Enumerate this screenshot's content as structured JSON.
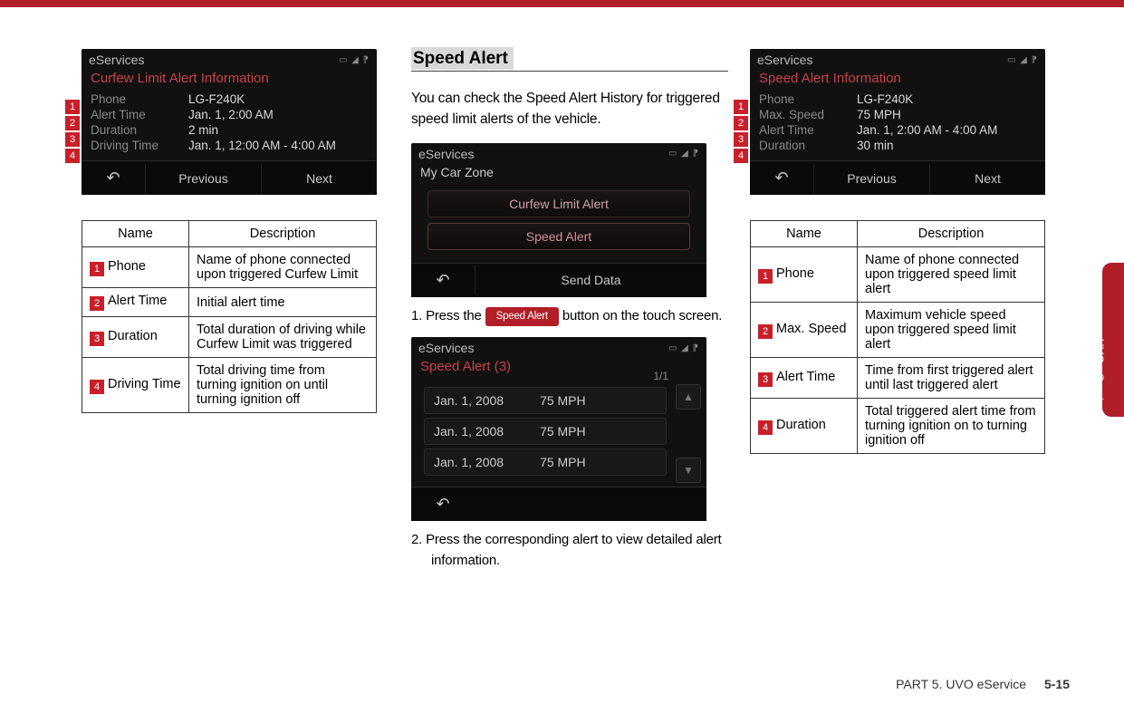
{
  "side_tab": "UVO eServices",
  "footer": {
    "part": "PART 5. UVO eService",
    "page": "5-15"
  },
  "col1": {
    "device": {
      "title": "eServices",
      "heading": "Curfew Limit Alert Information",
      "rows": [
        {
          "label": "Phone",
          "value": "LG-F240K"
        },
        {
          "label": "Alert Time",
          "value": "Jan. 1, 2:00 AM"
        },
        {
          "label": "Duration",
          "value": "2 min"
        },
        {
          "label": "Driving Time",
          "value": "Jan. 1, 12:00 AM - 4:00 AM"
        }
      ],
      "footer": {
        "back": "↶",
        "prev": "Previous",
        "next": "Next"
      }
    },
    "callouts": [
      "1",
      "2",
      "3",
      "4"
    ],
    "table": {
      "head": {
        "name": "Name",
        "desc": "Description"
      },
      "rows": [
        {
          "n": "1",
          "name": "Phone",
          "desc": "Name of phone connected upon triggered Curfew Limit"
        },
        {
          "n": "2",
          "name": "Alert Time",
          "desc": "Initial alert time"
        },
        {
          "n": "3",
          "name": "Duration",
          "desc": "Total duration of driving while Curfew Limit was triggered"
        },
        {
          "n": "4",
          "name": "Driving Time",
          "desc": "Total driving time from turning ignition on until turning ignition off"
        }
      ]
    }
  },
  "col2": {
    "section_title": "Speed Alert",
    "intro": "You can check the Speed Alert History for triggered speed limit alerts of the vehicle.",
    "deviceA": {
      "title": "eServices",
      "heading": "My Car Zone",
      "items": [
        "Curfew Limit Alert",
        "Speed Alert"
      ],
      "footer": {
        "back": "↶",
        "send": "Send Data"
      }
    },
    "step1_a": "1. Press the ",
    "step1_btn": "Speed Alert",
    "step1_b": " button on the touch screen.",
    "deviceB": {
      "title": "eServices",
      "heading": "Speed Alert (3)",
      "page": "1/1",
      "rows": [
        {
          "date": "Jan. 1, 2008",
          "speed": "75 MPH"
        },
        {
          "date": "Jan. 1, 2008",
          "speed": "75 MPH"
        },
        {
          "date": "Jan. 1, 2008",
          "speed": "75 MPH"
        }
      ],
      "footer": {
        "back": "↶"
      }
    },
    "step2": "2. Press the corresponding alert to view detailed alert information."
  },
  "col3": {
    "device": {
      "title": "eServices",
      "heading": "Speed Alert Information",
      "rows": [
        {
          "label": "Phone",
          "value": "LG-F240K"
        },
        {
          "label": "Max. Speed",
          "value": "75 MPH"
        },
        {
          "label": "Alert Time",
          "value": "Jan. 1, 2:00 AM - 4:00 AM"
        },
        {
          "label": "Duration",
          "value": "30 min"
        }
      ],
      "footer": {
        "back": "↶",
        "prev": "Previous",
        "next": "Next"
      }
    },
    "callouts": [
      "1",
      "2",
      "3",
      "4"
    ],
    "table": {
      "head": {
        "name": "Name",
        "desc": "Description"
      },
      "rows": [
        {
          "n": "1",
          "name": "Phone",
          "desc": "Name of phone connected upon triggered speed limit alert"
        },
        {
          "n": "2",
          "name": "Max. Speed",
          "desc": "Maximum vehicle speed upon triggered speed limit alert"
        },
        {
          "n": "3",
          "name": "Alert Time",
          "desc": "Time from first triggered alert until last triggered alert"
        },
        {
          "n": "4",
          "name": "Duration",
          "desc": "Total triggered alert time from turning ignition on to turning ignition off"
        }
      ]
    }
  }
}
